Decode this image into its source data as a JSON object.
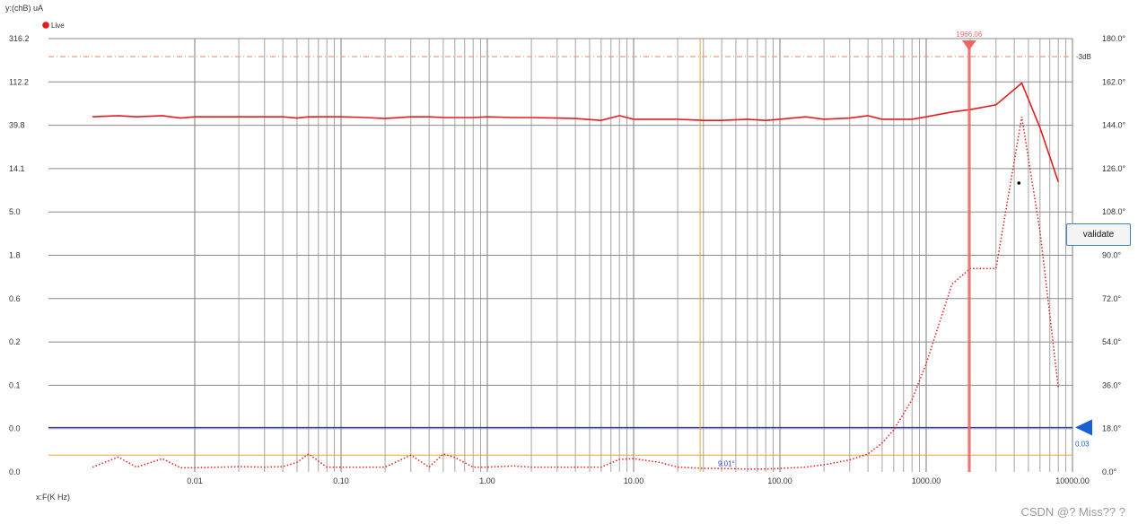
{
  "colors": {
    "series_line": "#e51c1c",
    "marker": "#ef6464",
    "cursor_h_blue": "#1a1aa0",
    "blue_marker": "#1a5fd6",
    "orange": "#e8a62f",
    "threshold": "#e9a27a",
    "grid": "#8a8a8a"
  },
  "validate_label": "validate",
  "watermark": "CSDN @? Miss?? ?",
  "chart_data": {
    "type": "line",
    "xlabel": "x:F(K Hz)",
    "ylabel": "y:(chB) uA",
    "xscale": "log",
    "xlim": [
      0.001,
      10000
    ],
    "x_ticks": [
      "0.01",
      "0.10",
      "1.00",
      "10.00",
      "100.00",
      "1000.00",
      "10000.00"
    ],
    "y_left_ticks": [
      "0.0",
      "0.0",
      "0.1",
      "0.2",
      "0.6",
      "1.8",
      "5.0",
      "14.1",
      "39.8",
      "112.2",
      "316.2"
    ],
    "y_right_ticks": [
      "0.0°",
      "18.0°",
      "36.0°",
      "54.0°",
      "72.0°",
      "90.0°",
      "108.0°",
      "126.0°",
      "144.0°",
      "162.0°",
      "180.0°"
    ],
    "y_right_range": [
      0,
      180
    ],
    "legend": [
      {
        "name": "Live",
        "color": "#e51c1c"
      }
    ],
    "grid": true,
    "threshold_label": "-3dB",
    "threshold_value": 172.5,
    "marker": {
      "label": "1966.06",
      "x": 1966.06
    },
    "orange_cursor_x": 28.5,
    "orange_cursor_y": 7,
    "phase_label": "9.01°",
    "blue_cursor": {
      "label": "0.03",
      "value": 18.5
    },
    "point": {
      "x": 4300,
      "y": 120
    },
    "series": [
      {
        "style": "solid",
        "x": [
          0.002,
          0.003,
          0.004,
          0.006,
          0.008,
          0.01,
          0.015,
          0.02,
          0.03,
          0.04,
          0.05,
          0.06,
          0.08,
          0.1,
          0.15,
          0.2,
          0.3,
          0.4,
          0.5,
          0.6,
          0.8,
          1,
          1.5,
          2,
          3,
          4,
          6,
          8,
          10,
          15,
          20,
          30,
          40,
          60,
          80,
          100,
          150,
          200,
          300,
          400,
          500,
          600,
          800,
          1000,
          1500,
          2000,
          3000,
          4500,
          6000,
          8000
        ],
        "y": [
          147.5,
          148,
          147.5,
          148,
          147,
          147.5,
          147.5,
          147.5,
          147.5,
          147.5,
          147,
          147.5,
          147.5,
          147.5,
          147.2,
          146.8,
          147.5,
          147.5,
          147.2,
          147.2,
          147.2,
          147.5,
          147.2,
          147.2,
          147,
          146.8,
          146,
          148,
          146.5,
          146.5,
          146.5,
          146,
          146,
          146.5,
          146,
          146.5,
          147.5,
          146.5,
          147,
          148,
          146.5,
          146.5,
          146.5,
          147.5,
          149.5,
          150.5,
          152.5,
          161.5,
          143,
          120.5
        ]
      },
      {
        "style": "dotted",
        "x": [
          0.002,
          0.003,
          0.004,
          0.006,
          0.008,
          0.01,
          0.015,
          0.02,
          0.03,
          0.04,
          0.05,
          0.06,
          0.08,
          0.1,
          0.15,
          0.2,
          0.3,
          0.4,
          0.5,
          0.6,
          0.8,
          1,
          1.5,
          2,
          3,
          4,
          6,
          8,
          10,
          15,
          20,
          30,
          40,
          60,
          80,
          100,
          150,
          200,
          300,
          400,
          500,
          600,
          800,
          1000,
          1500,
          2000,
          3000,
          4500,
          6000,
          8000
        ],
        "y": [
          2,
          6.2,
          2,
          5.5,
          1.8,
          1.8,
          2,
          2.2,
          2,
          2.2,
          4,
          7.5,
          2,
          2,
          2,
          2,
          7,
          2,
          7.5,
          6,
          2,
          2,
          2.5,
          2,
          2,
          2,
          2,
          5.2,
          5.5,
          4,
          2,
          1.5,
          1.5,
          1.2,
          1.2,
          1.5,
          2,
          3,
          5,
          7.5,
          12,
          17.5,
          30,
          45,
          78,
          84.5,
          84.5,
          147.5,
          100,
          35
        ]
      }
    ]
  }
}
